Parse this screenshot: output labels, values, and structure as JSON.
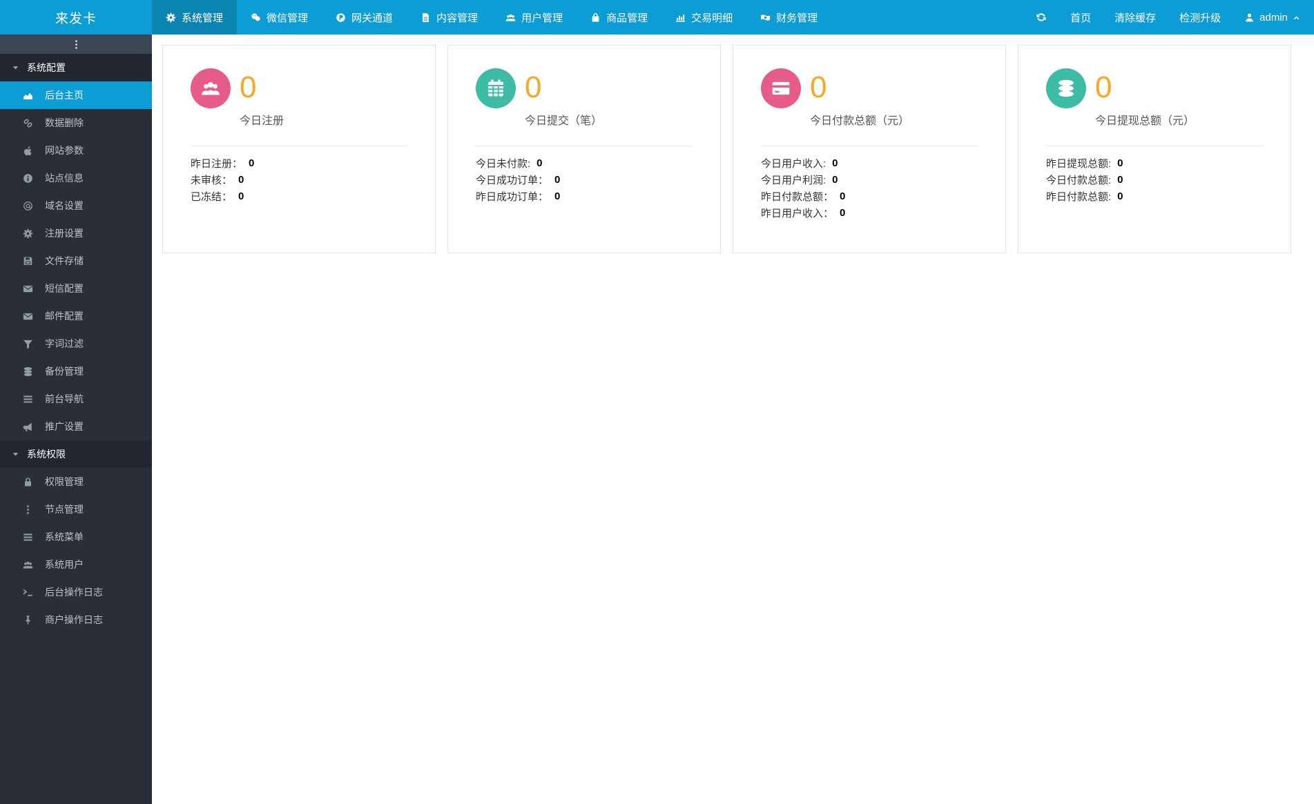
{
  "topbar": {
    "logo": "来发卡",
    "nav": [
      {
        "label": "系统管理",
        "icon": "gear-icon",
        "active": true
      },
      {
        "label": "微信管理",
        "icon": "wechat-icon",
        "active": false
      },
      {
        "label": "网关通道",
        "icon": "p-circle-icon",
        "active": false
      },
      {
        "label": "内容管理",
        "icon": "file-icon",
        "active": false
      },
      {
        "label": "用户管理",
        "icon": "users-icon",
        "active": false
      },
      {
        "label": "商品管理",
        "icon": "bag-icon",
        "active": false
      },
      {
        "label": "交易明细",
        "icon": "bar-chart-icon",
        "active": false
      },
      {
        "label": "财务管理",
        "icon": "money-icon",
        "active": false
      }
    ],
    "refresh_icon": "refresh-icon",
    "actions": [
      {
        "label": "首页"
      },
      {
        "label": "清除缓存"
      },
      {
        "label": "检测升级"
      }
    ],
    "user": {
      "label": "admin",
      "icon": "user-icon",
      "caret_icon": "caret-up-icon"
    }
  },
  "sidebar": {
    "toggle_icon": "ellipsis-v-icon",
    "sections": [
      {
        "label": "系统配置",
        "caret_icon": "caret-down-icon",
        "items": [
          {
            "label": "后台主页",
            "icon": "area-chart-icon",
            "active": true
          },
          {
            "label": "数据删除",
            "icon": "link-icon",
            "active": false
          },
          {
            "label": "网站参数",
            "icon": "apple-icon",
            "active": false
          },
          {
            "label": "站点信息",
            "icon": "info-icon",
            "active": false
          },
          {
            "label": "域名设置",
            "icon": "at-icon",
            "active": false
          },
          {
            "label": "注册设置",
            "icon": "gear-icon",
            "active": false
          },
          {
            "label": "文件存储",
            "icon": "save-icon",
            "active": false
          },
          {
            "label": "短信配置",
            "icon": "envelope-icon",
            "active": false
          },
          {
            "label": "邮件配置",
            "icon": "envelope-icon",
            "active": false
          },
          {
            "label": "字词过滤",
            "icon": "filter-icon",
            "active": false
          },
          {
            "label": "备份管理",
            "icon": "database-icon",
            "active": false
          },
          {
            "label": "前台导航",
            "icon": "bars-icon",
            "active": false
          },
          {
            "label": "推广设置",
            "icon": "bullhorn-icon",
            "active": false
          }
        ]
      },
      {
        "label": "系统权限",
        "caret_icon": "caret-down-icon",
        "items": [
          {
            "label": "权限管理",
            "icon": "lock-icon",
            "active": false
          },
          {
            "label": "节点管理",
            "icon": "ellipsis-v-icon",
            "active": false
          },
          {
            "label": "系统菜单",
            "icon": "bars-icon",
            "active": false
          },
          {
            "label": "系统用户",
            "icon": "users-icon",
            "active": false
          },
          {
            "label": "后台操作日志",
            "icon": "terminal-icon",
            "active": false
          },
          {
            "label": "商户操作日志",
            "icon": "thumbtack-icon",
            "active": false
          }
        ]
      }
    ]
  },
  "cards": [
    {
      "icon": "users-icon",
      "color": "#e75b8b",
      "value": "0",
      "label": "今日注册",
      "rows": [
        {
          "label": "昨日注册：",
          "value": "0"
        },
        {
          "label": "未审核：",
          "value": "0"
        },
        {
          "label": "已冻结：",
          "value": "0"
        }
      ]
    },
    {
      "icon": "calendar-icon",
      "color": "#3cbba5",
      "value": "0",
      "label": "今日提交（笔）",
      "rows": [
        {
          "label": "今日未付款:",
          "value": "0"
        },
        {
          "label": "今日成功订单：",
          "value": "0"
        },
        {
          "label": "昨日成功订单：",
          "value": "0"
        }
      ]
    },
    {
      "icon": "credit-card-icon",
      "color": "#e75b8b",
      "value": "0",
      "label": "今日付款总额（元）",
      "rows": [
        {
          "label": "今日用户收入:",
          "value": "0"
        },
        {
          "label": "今日用户利润:",
          "value": "0"
        },
        {
          "label": "昨日付款总额：",
          "value": "0"
        },
        {
          "label": "昨日用户收入：",
          "value": "0"
        }
      ]
    },
    {
      "icon": "database-icon",
      "color": "#3cbba5",
      "value": "0",
      "label": "今日提现总额（元）",
      "rows": [
        {
          "label": "昨日提现总额:",
          "value": "0"
        },
        {
          "label": "今日付款总额:",
          "value": "0"
        },
        {
          "label": "昨日付款总额:",
          "value": "0"
        }
      ]
    }
  ]
}
